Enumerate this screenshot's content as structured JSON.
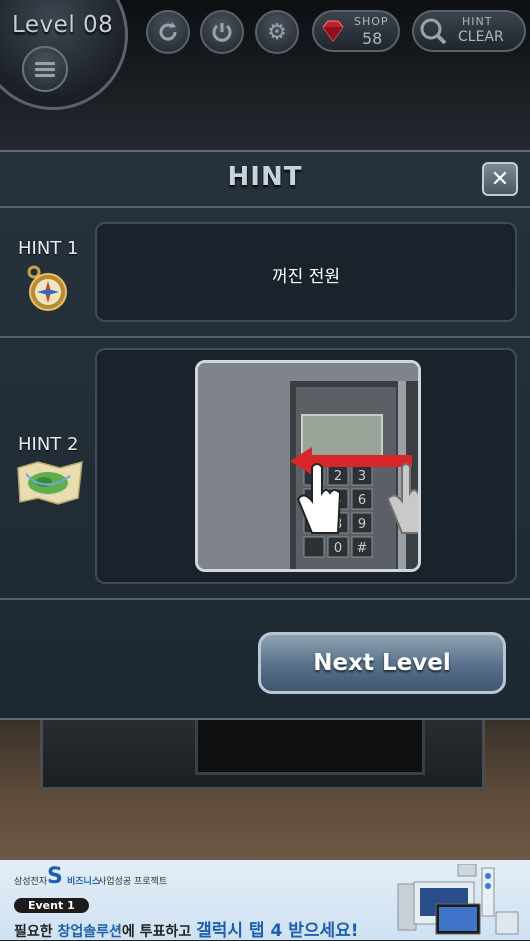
{
  "hud": {
    "level_label": "Level 08",
    "shop": {
      "label": "SHOP",
      "count": "58"
    },
    "hint": {
      "label": "HINT",
      "sub": "CLEAR"
    },
    "icons": [
      "menu-icon",
      "refresh-icon",
      "power-icon",
      "gear-icon",
      "ruby-icon",
      "magnifier-icon"
    ]
  },
  "modal": {
    "title": "HINT",
    "close_symbol": "✕",
    "hints": [
      {
        "label": "HINT 1",
        "icon": "compass-icon",
        "text": "꺼진 전원"
      },
      {
        "label": "HINT 2",
        "icon": "map-icon",
        "image": "keypad-swipe-left"
      }
    ],
    "next_button": "Next Level"
  },
  "ad": {
    "brand": "삼성전자",
    "s_logo": "S",
    "biz": "비즈니스",
    "project": "사업성공 프로젝트",
    "event": "Event 1",
    "line_part1": "필요한 ",
    "line_part2": "창업솔루션",
    "line_part3": "에 투표하고 ",
    "line_part4": "갤럭시 탭 4 받으세요!"
  },
  "colors": {
    "modal_bg": "#222c35",
    "button_blue": "#58708a",
    "arrow_red": "#d9262a"
  }
}
